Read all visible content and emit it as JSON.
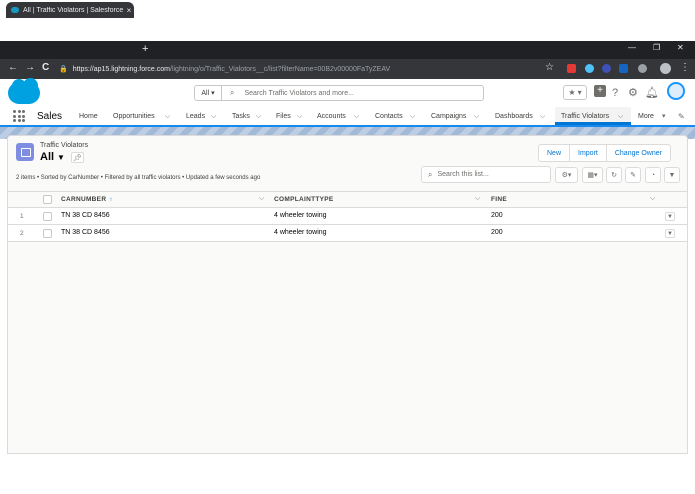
{
  "browser": {
    "tab_title": "All | Traffic Violators | Salesforce",
    "tab_close": "×",
    "new_tab": "+",
    "url_host": "https://ap15.lightning.force.com",
    "url_path": "/lightning/o/Traffic_Vialotors__c/list?filterName=00B2v00000FaTyZEAV",
    "back": "←",
    "forward": "→",
    "reload": "C",
    "lock": "🔒",
    "star": "☆",
    "menu": "⋮",
    "minimize": "—",
    "maximize": "❐",
    "close": "✕"
  },
  "header": {
    "search_scope": "All",
    "search_placeholder": "Search Traffic Violators and more...",
    "icons": [
      "favorites-icon",
      "add-icon",
      "help-icon",
      "setup-icon",
      "notifications-icon",
      "avatar"
    ]
  },
  "nav": {
    "app_name": "Sales",
    "items": [
      {
        "label": "Home"
      },
      {
        "label": "Opportunities"
      },
      {
        "label": "Leads"
      },
      {
        "label": "Tasks"
      },
      {
        "label": "Files"
      },
      {
        "label": "Accounts"
      },
      {
        "label": "Contacts"
      },
      {
        "label": "Campaigns"
      },
      {
        "label": "Dashboards"
      },
      {
        "label": "Traffic Violators"
      },
      {
        "label": "More"
      }
    ]
  },
  "list": {
    "object_name": "Traffic Violators",
    "view_name": "All",
    "buttons": {
      "new": "New",
      "import": "Import",
      "change_owner": "Change Owner"
    },
    "summary": "2 items • Sorted by CarNumber • Filtered by all traffic violators • Updated a few seconds ago",
    "search_placeholder": "Search this list...",
    "columns": [
      "CARNUMBER",
      "COMPLAINTTYPE",
      "FINE"
    ],
    "rows": [
      {
        "num": "1",
        "carnumber": "TN 38 CD 8456",
        "complainttype": "4 wheeler towing",
        "fine": "200"
      },
      {
        "num": "2",
        "carnumber": "TN 38 CD 8456",
        "complainttype": "4 wheeler towing",
        "fine": "200"
      }
    ]
  },
  "colors": {
    "brand": "#00a1e0",
    "accent": "#0176d3",
    "object_icon": "#7f8de1",
    "chrome_dark": "#202124"
  }
}
